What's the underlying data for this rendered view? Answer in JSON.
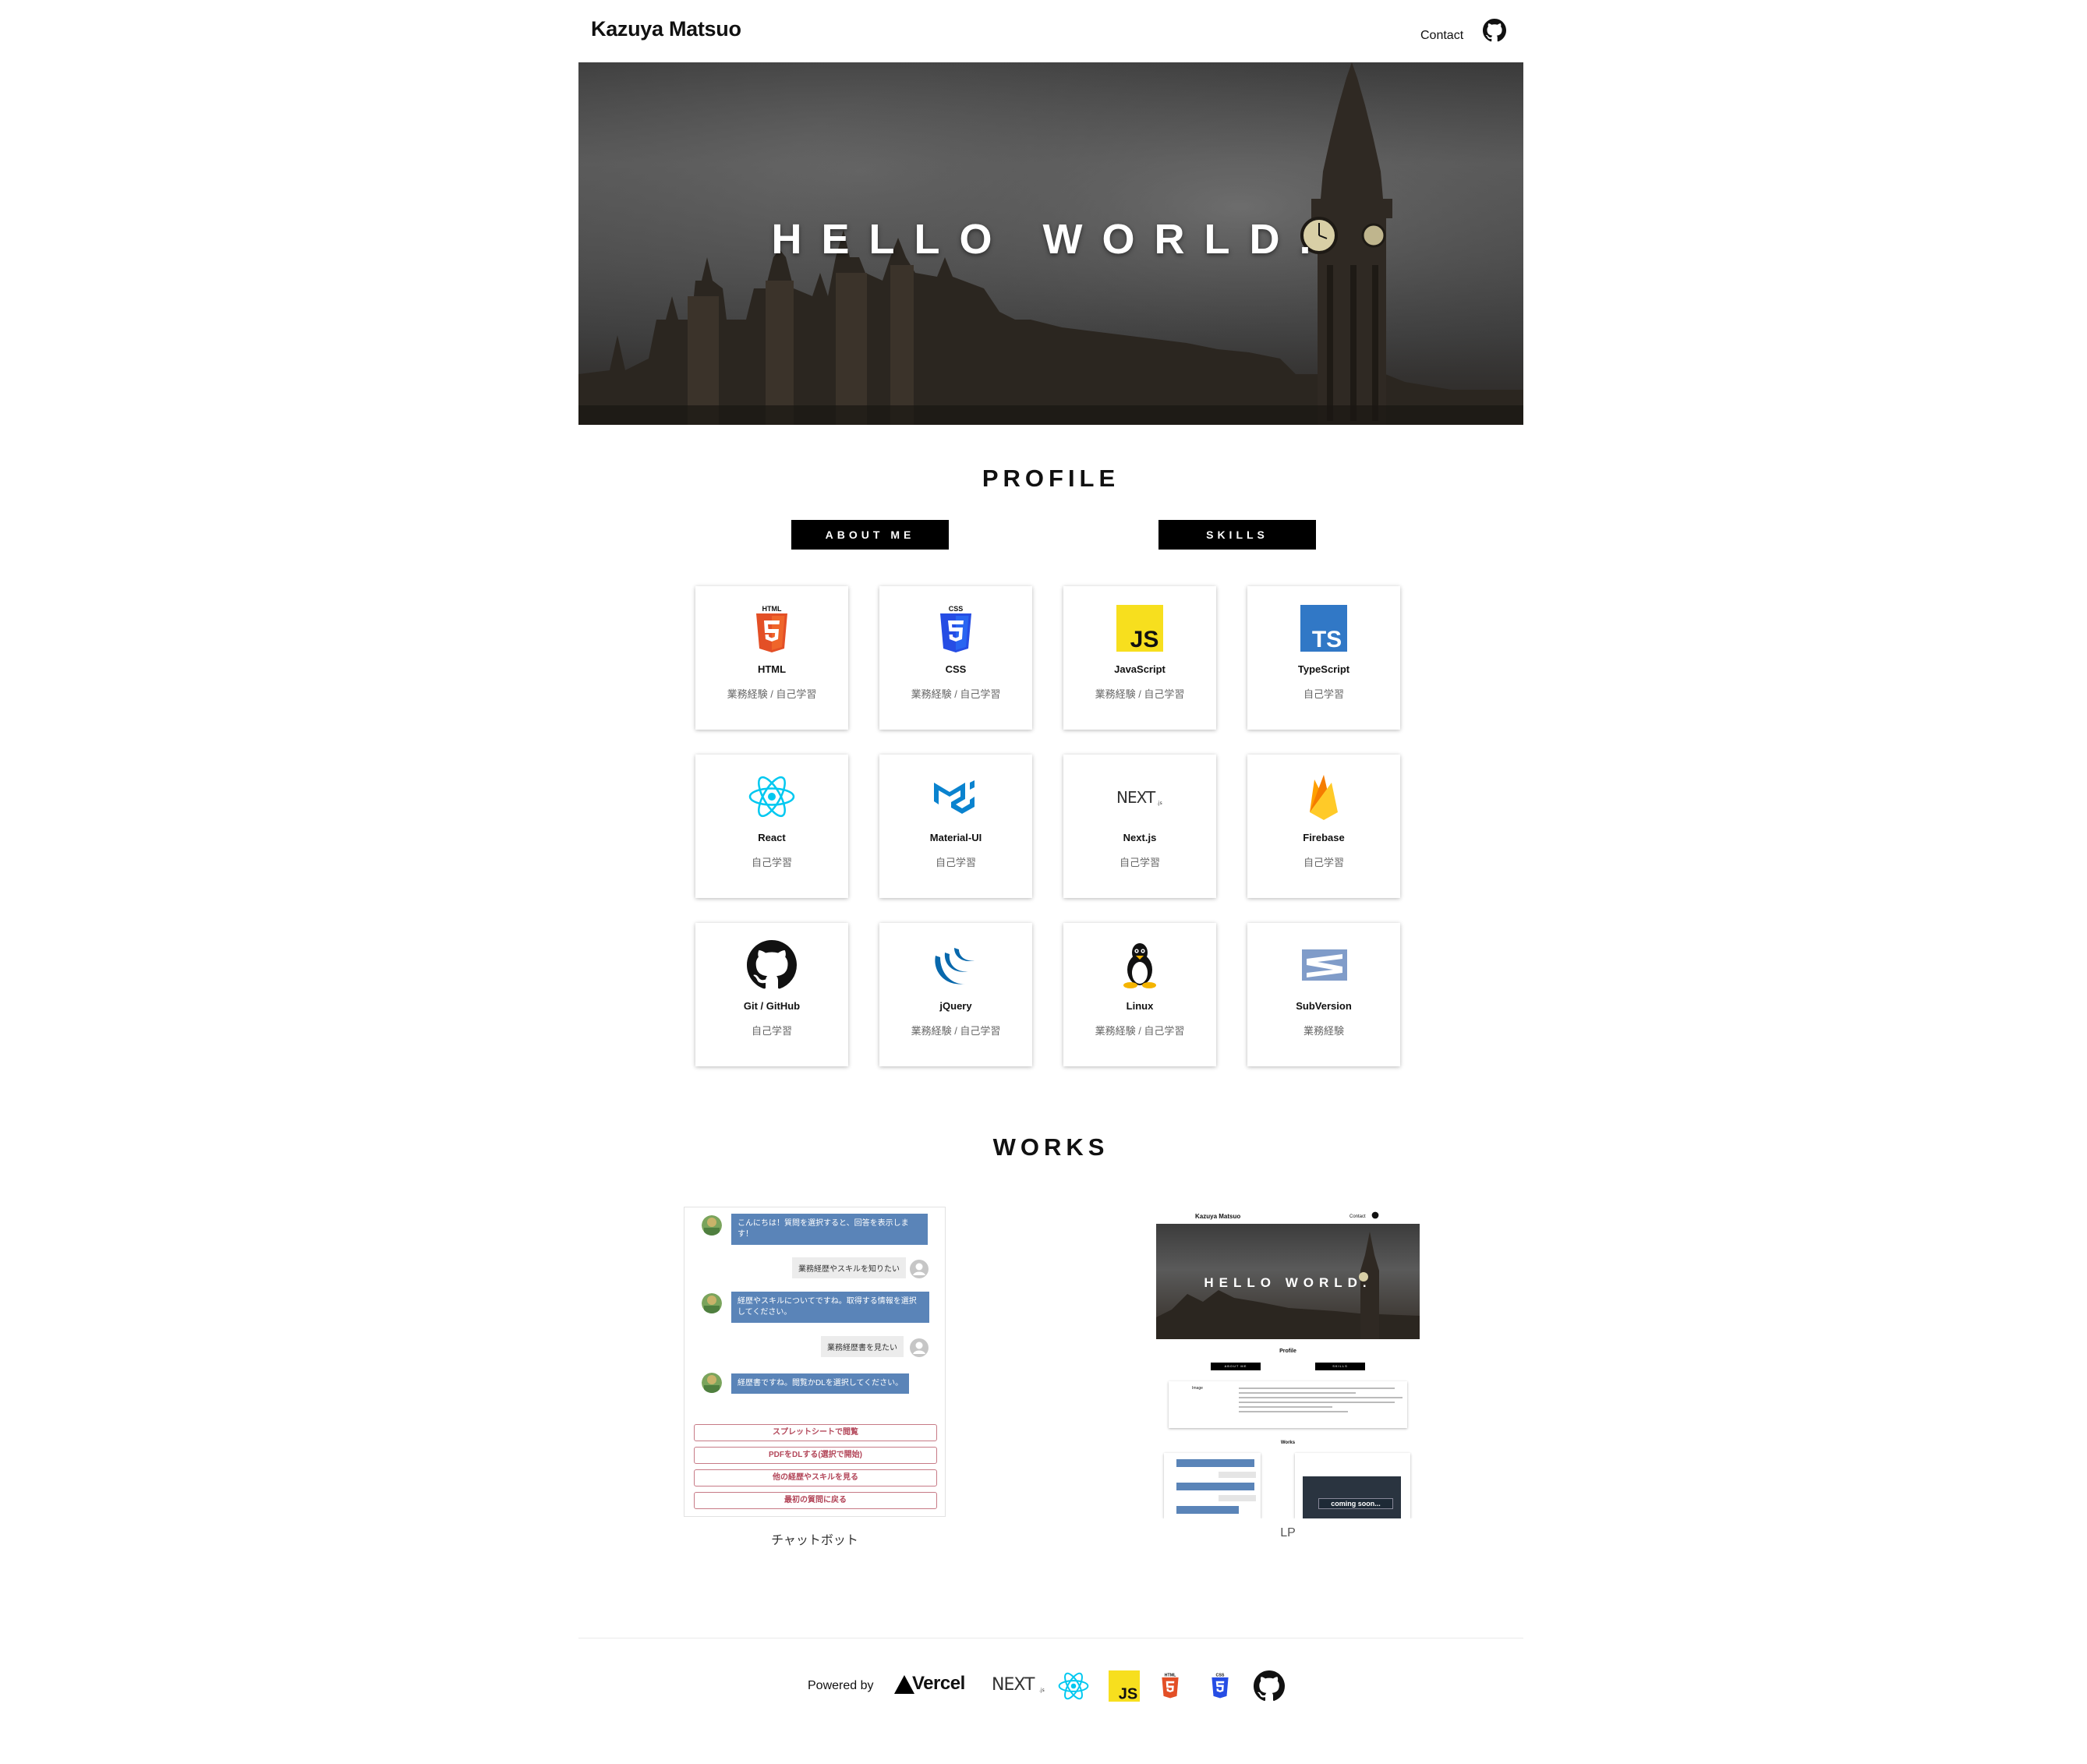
{
  "header": {
    "brand": "Kazuya Matsuo",
    "contact": "Contact",
    "github_icon": "github-icon"
  },
  "hero": {
    "title": "HELLO WORLD."
  },
  "profile": {
    "title": "PROFILE",
    "tabs": [
      "ABOUT ME",
      "SKILLS"
    ],
    "skills": [
      {
        "name": "HTML",
        "level": "業務経験 / 自己学習",
        "icon": "html5-icon"
      },
      {
        "name": "CSS",
        "level": "業務経験 / 自己学習",
        "icon": "css3-icon"
      },
      {
        "name": "JavaScript",
        "level": "業務経験 / 自己学習",
        "icon": "javascript-icon"
      },
      {
        "name": "TypeScript",
        "level": "自己学習",
        "icon": "typescript-icon"
      },
      {
        "name": "React",
        "level": "自己学習",
        "icon": "react-icon"
      },
      {
        "name": "Material-UI",
        "level": "自己学習",
        "icon": "material-ui-icon"
      },
      {
        "name": "Next.js",
        "level": "自己学習",
        "icon": "nextjs-icon"
      },
      {
        "name": "Firebase",
        "level": "自己学習",
        "icon": "firebase-icon"
      },
      {
        "name": "Git / GitHub",
        "level": "自己学習",
        "icon": "github-icon"
      },
      {
        "name": "jQuery",
        "level": "業務経験 / 自己学習",
        "icon": "jquery-icon"
      },
      {
        "name": "Linux",
        "level": "業務経験 / 自己学習",
        "icon": "linux-icon"
      },
      {
        "name": "SubVersion",
        "level": "業務経験",
        "icon": "subversion-icon"
      }
    ]
  },
  "works": {
    "title": "WORKS",
    "items": [
      {
        "caption": "チャットボット",
        "messages": [
          "こんにちは！質問を選択すると、回答を表示します！",
          "業務経歴やスキルを知りたい",
          "経歴やスキルについてですね。取得する情報を選択してください。",
          "業務経歴書を見たい",
          "経歴書ですね。閲覧かDLを選択してください。"
        ],
        "options": [
          "スプレットシートで閲覧",
          "PDFをDLする(選択で開始)",
          "他の経歴やスキルを見る",
          "最初の質問に戻る"
        ]
      },
      {
        "caption": "LP",
        "mini": {
          "brand": "Kazuya Matsuo",
          "contact": "Contact",
          "hero": "HELLO WORLD.",
          "profile": "Profile",
          "tabs": [
            "ABOUT ME",
            "SKILLS"
          ],
          "image_label": "Image",
          "works": "Works",
          "coming_soon": "coming soon..."
        }
      }
    ]
  },
  "footer": {
    "powered_by": "Powered by",
    "vercel": "Vercel",
    "icons": [
      "vercel-icon",
      "nextjs-icon",
      "react-icon",
      "javascript-icon",
      "html5-icon",
      "css3-icon",
      "github-icon"
    ]
  },
  "colors": {
    "accent": "#000000",
    "chat_bubble": "#5a84b8",
    "react": "#61dafb",
    "js": "#f7df1e",
    "ts": "#3178c6",
    "html": "#e34f26",
    "css": "#264de4"
  }
}
